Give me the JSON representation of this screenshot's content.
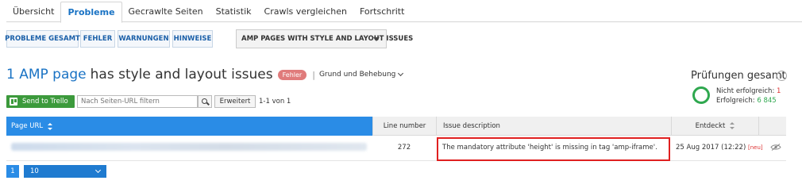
{
  "tabs": [
    {
      "label": "Übersicht",
      "active": false
    },
    {
      "label": "Probleme",
      "active": true
    },
    {
      "label": "Gecrawlte Seiten",
      "active": false
    },
    {
      "label": "Statistik",
      "active": false
    },
    {
      "label": "Crawls vergleichen",
      "active": false
    },
    {
      "label": "Fortschritt",
      "active": false
    }
  ],
  "filters": {
    "all": "PROBLEME GESAMT",
    "errors": "FEHLER",
    "warnings": "WARNUNGEN",
    "notices": "HINWEISE",
    "dropdown": "AMP PAGES WITH STYLE AND LAYOUT ISSUES"
  },
  "headline": {
    "link": "1 AMP page",
    "rest": "has style and layout issues",
    "badge": "Fehler",
    "separator": "|",
    "reasons": "Grund und Behebung"
  },
  "checks": {
    "title": "Prüfungen gesamt",
    "info_icon": "i",
    "failed_label": "Nicht erfolgreich:",
    "failed_value": "1",
    "success_label": "Erfolgreich:",
    "success_value": "6 845",
    "colors": {
      "failed": "#dd3333",
      "success": "#2fa84f"
    }
  },
  "toolbar": {
    "trello": "Send to Trello",
    "filter_placeholder": "Nach Seiten-URL filtern",
    "advanced": "Erweitert",
    "count": "1-1 von 1"
  },
  "table": {
    "headers": {
      "url": "Page URL",
      "line": "Line number",
      "issue": "Issue description",
      "found": "Entdeckt"
    },
    "rows": [
      {
        "line": "272",
        "issue": "The mandatory attribute 'height' is missing in tag 'amp-iframe'.",
        "found": "25 Aug 2017 (12:22)",
        "new_badge": "[neu]"
      }
    ]
  },
  "pagination": {
    "page": "1",
    "per_page": "10"
  },
  "colors": {
    "accent": "#2a8ce6",
    "link": "#1a73c4",
    "trello": "#3c9a3c",
    "highlight": "#e02020"
  }
}
